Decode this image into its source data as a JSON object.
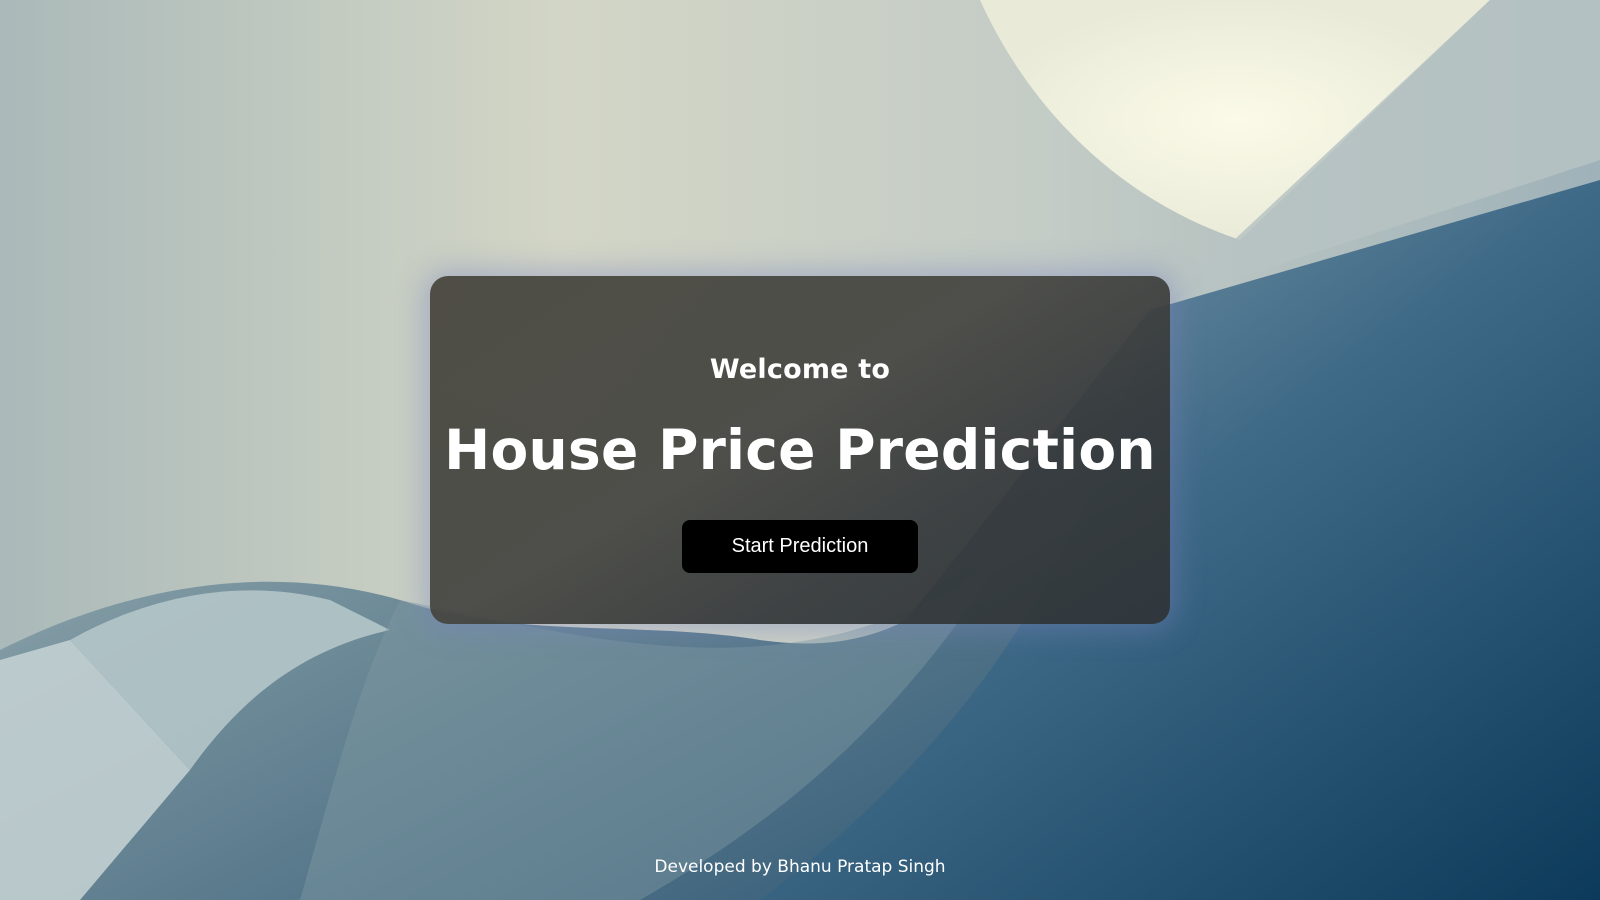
{
  "hero": {
    "welcome_text": "Welcome to",
    "title": "House Price Prediction",
    "start_button_label": "Start Prediction"
  },
  "footer": {
    "credit": "Developed by Bhanu Pratap Singh"
  },
  "colors": {
    "card_background": "#4a4840",
    "button_background": "#000000",
    "text": "#ffffff"
  }
}
